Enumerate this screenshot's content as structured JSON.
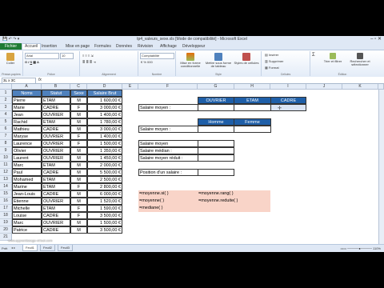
{
  "window": {
    "title": "tp4_valeurs_sexe.xls [Mode de compatibilité] - Microsoft Excel",
    "controls": "– ▫ ✕"
  },
  "ribbon": {
    "file_tab": "Fichier",
    "tabs": [
      "Accueil",
      "Insertion",
      "Mise en page",
      "Formules",
      "Données",
      "Révision",
      "Affichage",
      "Développeur"
    ],
    "active_tab_index": 0,
    "groups": {
      "clipboard": "Presse-papiers",
      "font": "Police",
      "alignment": "Alignement",
      "number": "Nombre",
      "number_format": "Comptabilité",
      "style": "Style",
      "cells": "Cellules",
      "edit": "Édition"
    },
    "buttons": {
      "paste": "Coller",
      "font_name": "Arial",
      "font_size": "10",
      "conditional": "Mise en forme conditionnelle",
      "as_table": "Mettre sous forme de tableau",
      "cell_styles": "Styles de cellules",
      "insert": "Insérer",
      "delete": "Supprimer",
      "format": "Format",
      "sort": "Trier et filtrer",
      "find": "Rechercher et sélectionner"
    }
  },
  "formula_bar": {
    "name_box": "3L x 3C",
    "fx": "fx"
  },
  "columns": [
    "A",
    "B",
    "C",
    "D",
    "E",
    "F",
    "G",
    "H",
    "I",
    "J",
    "K"
  ],
  "rows": [
    "1",
    "2",
    "3",
    "4",
    "5",
    "6",
    "7",
    "8",
    "9",
    "10",
    "11",
    "12",
    "13",
    "14",
    "15",
    "16",
    "17",
    "18",
    "19",
    "20",
    "21"
  ],
  "table": {
    "headers": [
      "Noms",
      "Statut",
      "Sexe",
      "Salaire Brut"
    ],
    "rows": [
      [
        "Pierre",
        "ETAM",
        "M",
        "1 600,00 €"
      ],
      [
        "Marie",
        "CADRE",
        "F",
        "3 000,00 €"
      ],
      [
        "Jean",
        "OUVRIER",
        "M",
        "1 400,00 €"
      ],
      [
        "Rachid",
        "ETAM",
        "M",
        "1 780,00 €"
      ],
      [
        "Mathieu",
        "CADRE",
        "M",
        "3 000,00 €"
      ],
      [
        "Maryse",
        "OUVRIER",
        "F",
        "1 400,00 €"
      ],
      [
        "Laurence",
        "OUVRIER",
        "F",
        "1 500,00 €"
      ],
      [
        "Olivier",
        "OUVRIER",
        "M",
        "1 350,00 €"
      ],
      [
        "Laurent",
        "OUVRIER",
        "M",
        "1 450,00 €"
      ],
      [
        "Marc",
        "ETAM",
        "M",
        "2 000,00 €"
      ],
      [
        "Paul",
        "CADRE",
        "M",
        "5 500,00 €"
      ],
      [
        "Mohamed",
        "ETAM",
        "M",
        "2 500,00 €"
      ],
      [
        "Marine",
        "ETAM",
        "F",
        "2 800,00 €"
      ],
      [
        "Jean-Louis",
        "CADRE",
        "M",
        "6 000,00 €"
      ],
      [
        "Etienne",
        "OUVRIER",
        "M",
        "1 520,00 €"
      ],
      [
        "Michelle",
        "ETAM",
        "F",
        "1 590,00 €"
      ],
      [
        "Louise",
        "CADRE",
        "F",
        "3 500,00 €"
      ],
      [
        "Marc",
        "OUVRIER",
        "M",
        "1 500,00 €"
      ],
      [
        "Patrice",
        "CADRE",
        "M",
        "3 500,00 €"
      ]
    ]
  },
  "summary": {
    "status_headers": [
      "OUVRIER",
      "ETAM",
      "CADRE"
    ],
    "sex_headers": [
      "Homme",
      "Femme"
    ],
    "labels": {
      "salaire_moyen_1": "Salaire moyen :",
      "salaire_moyen_2": "Salaire moyen :",
      "salaire_moyen_3": "Salaire moyen",
      "salaire_median": "Salaire médian :",
      "salaire_moyen_reduit": "Salaire moyen réduit :",
      "position": "Position d'un salaire :"
    },
    "hints": {
      "moyenne_si": "=moyenne.si( )",
      "moyenne_rang": "=moyenne.rang( )",
      "moyenne": "=moyenne( )",
      "moyenne_reduite": "=moyenne.reduite( )",
      "mediane": "=mediane( )"
    }
  },
  "status_bar": {
    "ready": "Prêt",
    "sheets": [
      "Feuil1",
      "Feuil2",
      "Feuil3"
    ],
    "watermark": "www.apprentissage-virtuel.com"
  }
}
